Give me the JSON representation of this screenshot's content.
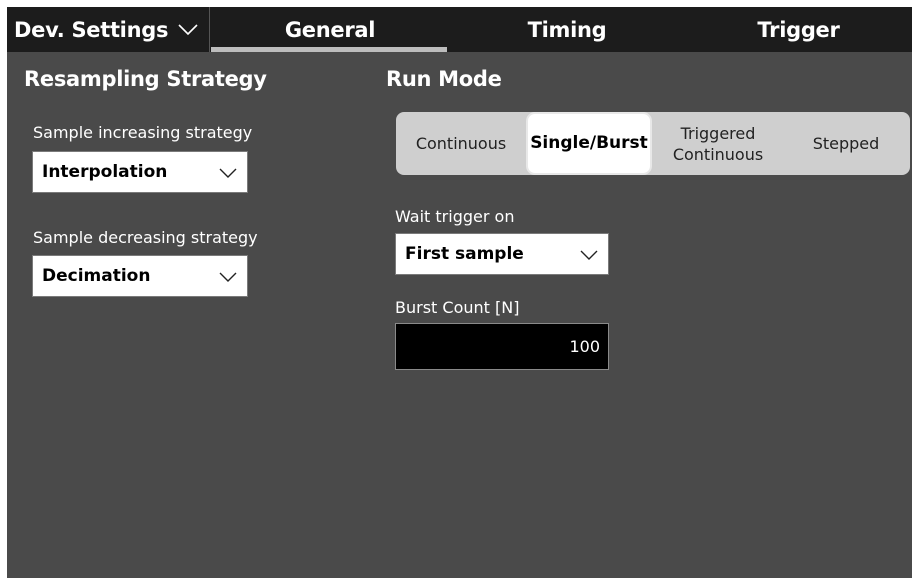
{
  "header": {
    "dev_settings_label": "Dev. Settings",
    "tabs": [
      {
        "label": "General",
        "selected": true
      },
      {
        "label": "Timing",
        "selected": false
      },
      {
        "label": "Trigger",
        "selected": false
      }
    ]
  },
  "resampling": {
    "title": "Resampling Strategy",
    "increasing_label": "Sample increasing strategy",
    "increasing_value": "Interpolation",
    "decreasing_label": "Sample decreasing strategy",
    "decreasing_value": "Decimation"
  },
  "run_mode": {
    "title": "Run Mode",
    "options": [
      "Continuous",
      "Single/Burst",
      "Triggered Continuous",
      "Stepped"
    ],
    "selected": "Single/Burst",
    "wait_trigger_label": "Wait trigger on",
    "wait_trigger_value": "First sample",
    "burst_count_label": "Burst Count [N]",
    "burst_count_value": "100"
  },
  "colors": {
    "background": "#4a4a4a",
    "topbar": "#1c1c1c",
    "tab_underline": "#bdbdbd",
    "segment_bg": "#cfcfcf",
    "segment_selected": "#ffffff"
  }
}
